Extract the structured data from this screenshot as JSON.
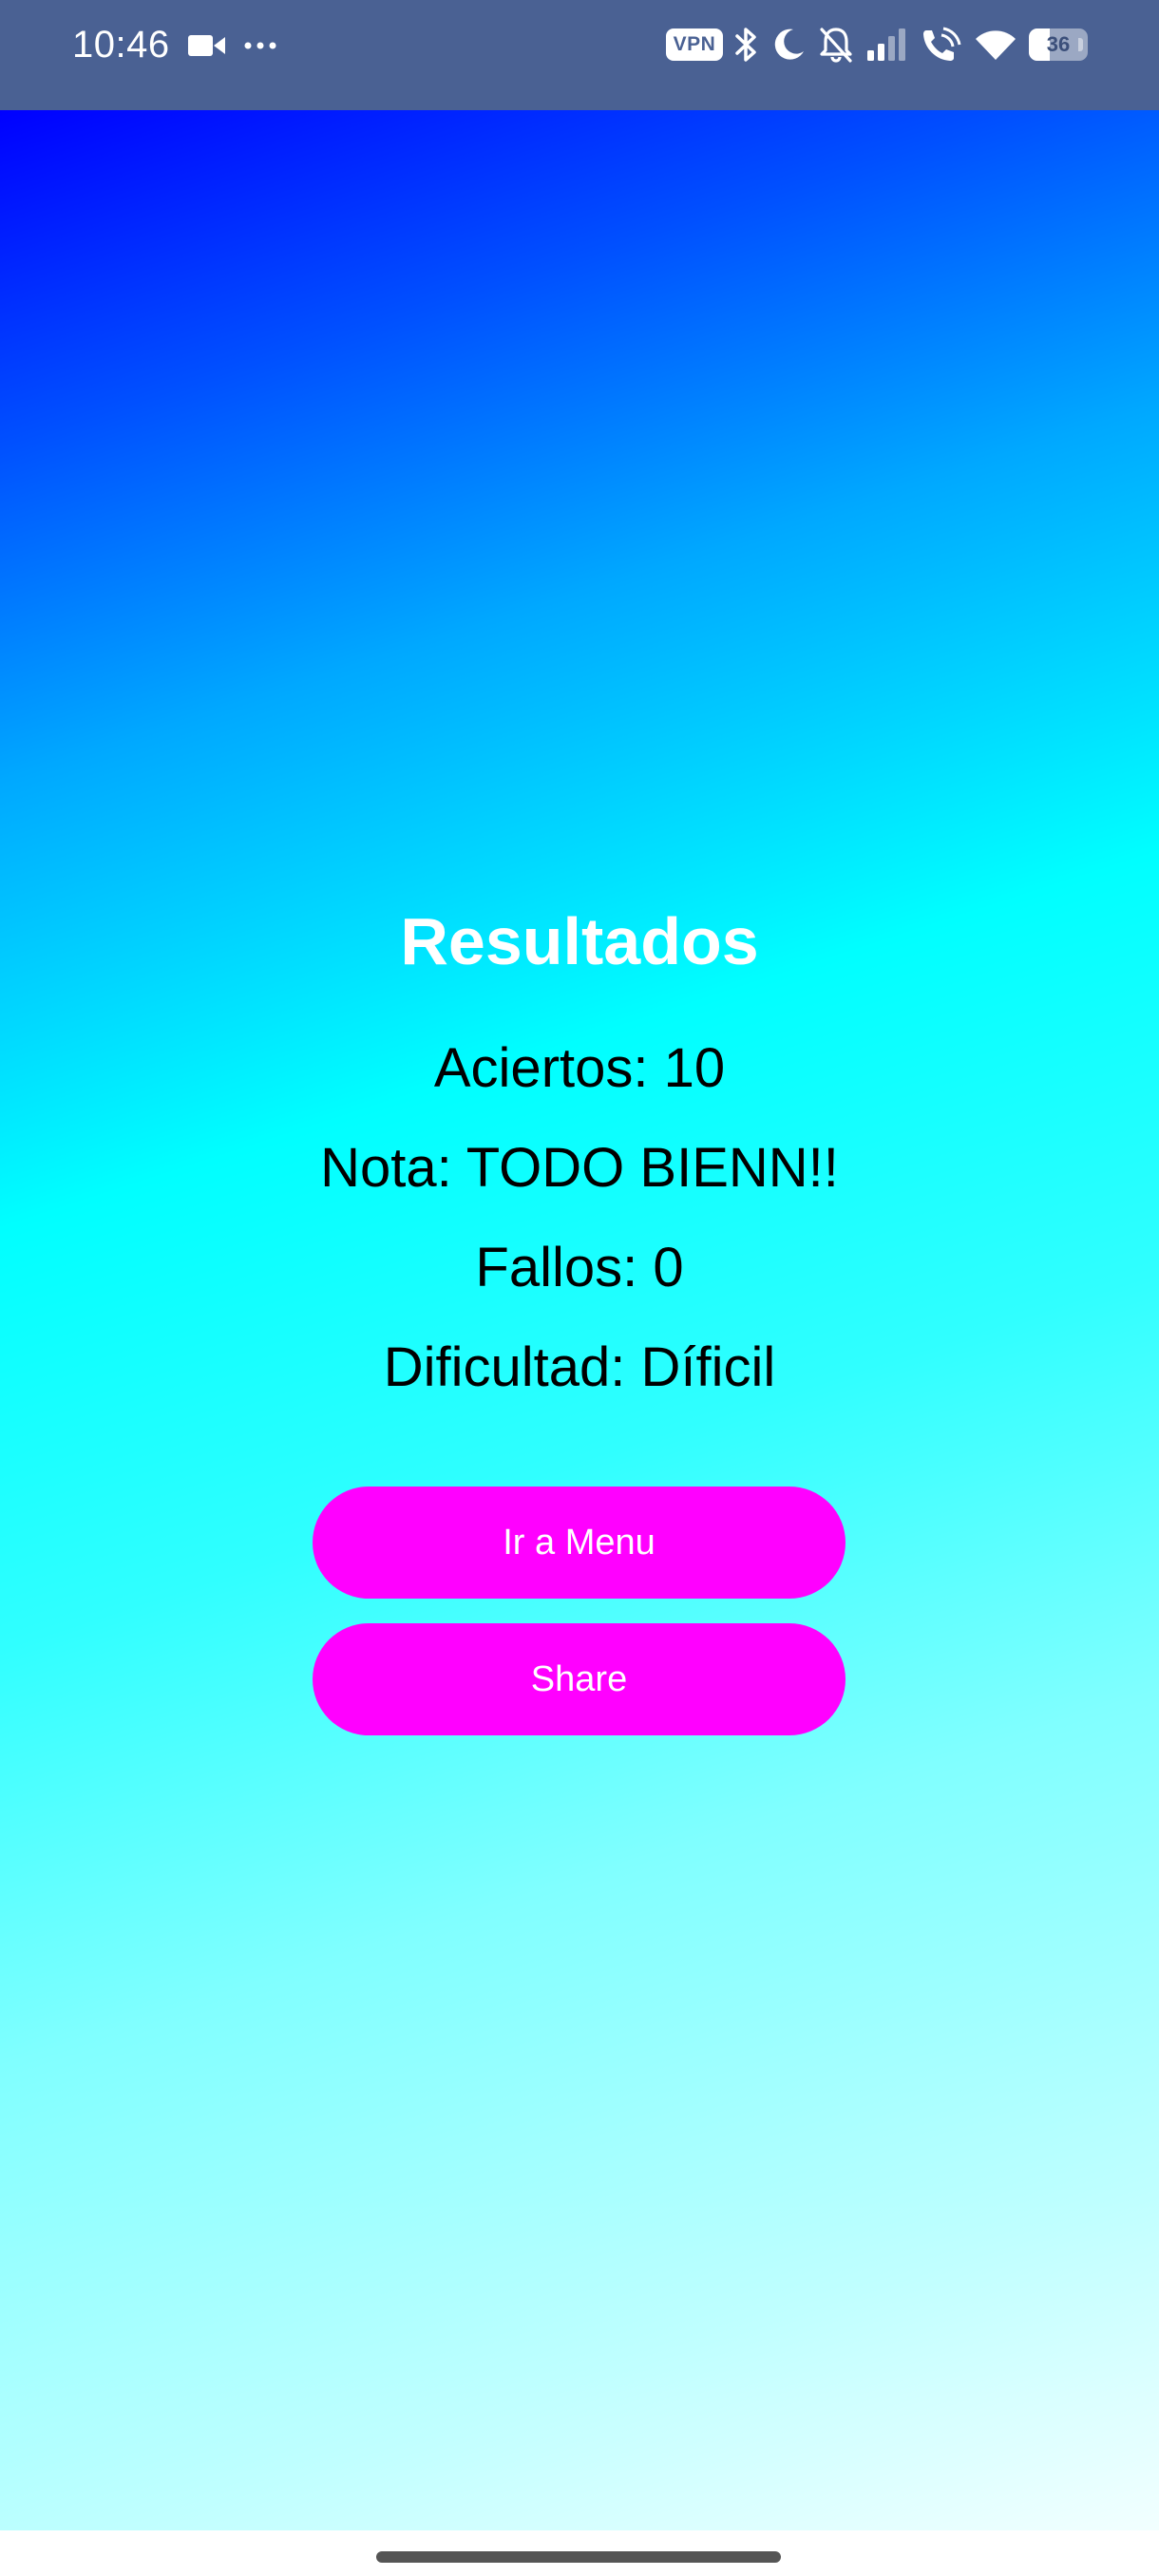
{
  "status_bar": {
    "time": "10:46",
    "left_icons": [
      "video-camera-icon",
      "more-dots-icon"
    ],
    "vpn_label": "VPN",
    "right_icons": [
      "bluetooth-icon",
      "moon-icon",
      "bell-off-icon",
      "signal-icon",
      "wifi-calling-icon",
      "wifi-icon",
      "battery-icon"
    ],
    "battery_level": "36"
  },
  "results": {
    "title": "Resultados",
    "aciertos": "Aciertos: 10",
    "nota": "Nota: TODO BIENN!!",
    "fallos": "Fallos: 0",
    "dificultad": "Dificultad: Díficil"
  },
  "buttons": {
    "menu_label": "Ir a Menu",
    "share_label": "Share"
  },
  "colors": {
    "status_bar": "#4a6193",
    "button": "#ff00ff",
    "gradient_start": "#0000ff",
    "gradient_mid": "#00ffff",
    "gradient_end": "#f2ffff"
  }
}
